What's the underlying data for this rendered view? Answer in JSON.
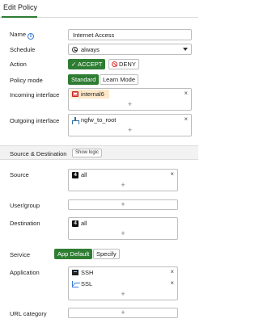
{
  "header": {
    "title": "Edit Policy"
  },
  "name": {
    "label": "Name",
    "value": "Internet Access"
  },
  "schedule": {
    "label": "Schedule",
    "value": "always"
  },
  "action": {
    "label": "Action",
    "accept": "✓ ACCEPT",
    "deny": "DENY",
    "selected": "ACCEPT"
  },
  "policy_mode": {
    "label": "Policy mode",
    "options": [
      "Standard",
      "Learn Mode"
    ],
    "selected": "Standard"
  },
  "incoming_interface": {
    "label": "Incoming interface",
    "items": [
      "internal6"
    ]
  },
  "outgoing_interface": {
    "label": "Outgoing interface",
    "items": [
      "ngfw_to_root"
    ]
  },
  "section": {
    "title": "Source & Destination",
    "show_logic": "Show logic"
  },
  "source": {
    "label": "Source",
    "items": [
      "all"
    ]
  },
  "user_group": {
    "label": "User/group",
    "items": []
  },
  "destination": {
    "label": "Destination",
    "items": [
      "all"
    ]
  },
  "service": {
    "label": "Service",
    "options": [
      "App Default",
      "Specify"
    ],
    "selected": "App Default"
  },
  "application": {
    "label": "Application",
    "items": [
      "SSH",
      "SSL"
    ]
  },
  "url_category": {
    "label": "URL category",
    "items": []
  },
  "glyphs": {
    "remove": "×",
    "add": "+",
    "address_badge": "4"
  },
  "colors": {
    "accent": "#2e7d32",
    "deny": "#d32f2f",
    "info": "#3a7bd5",
    "interface_highlight": "#fde9c9"
  }
}
